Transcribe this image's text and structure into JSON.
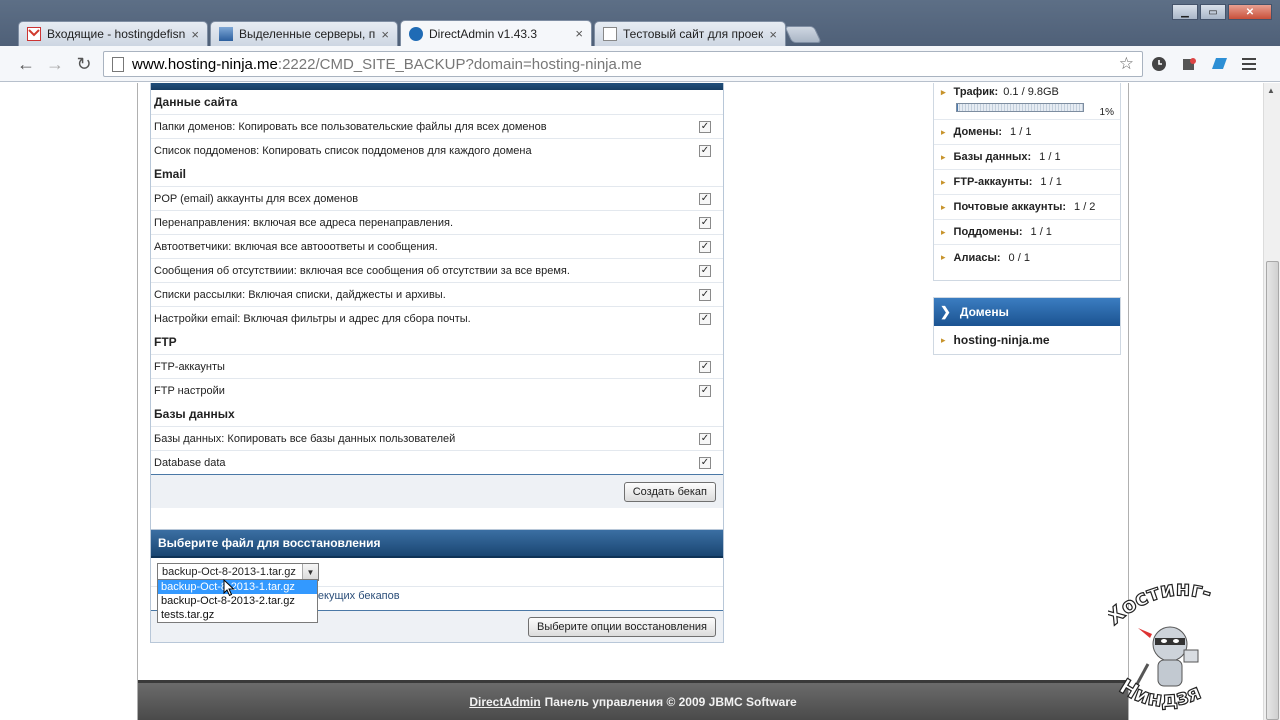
{
  "browser": {
    "tabs": [
      {
        "label": "Входящие - hostingdefisn",
        "active": false
      },
      {
        "label": "Выделенные серверы, пл",
        "active": false
      },
      {
        "label": "DirectAdmin v1.43.3",
        "active": true
      },
      {
        "label": "Тестовый сайт для проек",
        "active": false
      }
    ],
    "url_host": "www.hosting-ninja.me",
    "url_rest": ":2222/CMD_SITE_BACKUP?domain=hosting-ninja.me"
  },
  "backup": {
    "sections": [
      {
        "title": "Данные сайта",
        "rows": [
          "Папки доменов: Копировать все пользовательские файлы для всех доменов",
          "Список поддоменов: Копировать список поддоменов для каждого домена"
        ]
      },
      {
        "title": "Email",
        "rows": [
          "POP (email) аккаунты для всех доменов",
          "Перенаправления: включая все адреса перенаправления.",
          "Автоответчики: включая все автооответы и сообщения.",
          "Сообщения об отсутствиии: включая все сообщения об отсутствии за все время.",
          "Списки рассылки: Включая списки, дайджесты и архивы.",
          "Настройки email: Включая фильтры и адрес для сбора почты."
        ]
      },
      {
        "title": "FTP",
        "rows": [
          "FTP-аккаунты",
          "FTP настройи"
        ]
      },
      {
        "title": "Базы данных",
        "rows": [
          "Базы данных: Копировать все базы данных пользователей",
          "Database data"
        ]
      }
    ],
    "create_button": "Создать бекап"
  },
  "restore": {
    "title": "Выберите файл для восстановления",
    "selected": "backup-Oct-8-2013-1.tar.gz",
    "options": [
      "backup-Oct-8-2013-1.tar.gz",
      "backup-Oct-8-2013-2.tar.gz",
      "tests.tar.gz"
    ],
    "link_tail": "текущих бекапов",
    "options_button": "Выберите опции восстановления"
  },
  "stats": {
    "traffic_label": "Трафик:",
    "traffic_value": "0.1 / 9.8GB",
    "traffic_percent": "1%",
    "traffic_fraction": 0.01,
    "items": [
      {
        "label": "Домены:",
        "value": "1 / 1"
      },
      {
        "label": "Базы данных:",
        "value": "1 / 1"
      },
      {
        "label": "FTP-аккаунты:",
        "value": "1 / 1"
      },
      {
        "label": "Почтовые аккаунты:",
        "value": "1 / 2"
      },
      {
        "label": "Поддомены:",
        "value": "1 / 1"
      },
      {
        "label": "Алиасы:",
        "value": "0 / 1"
      }
    ]
  },
  "domains": {
    "title": "Домены",
    "items": [
      "hosting-ninja.me"
    ]
  },
  "footer": {
    "link": "DirectAdmin",
    "text": "Панель управления © 2009 JBMC Software"
  },
  "watermark": {
    "top": "Хостинг-",
    "bottom": "Ниндзя"
  }
}
